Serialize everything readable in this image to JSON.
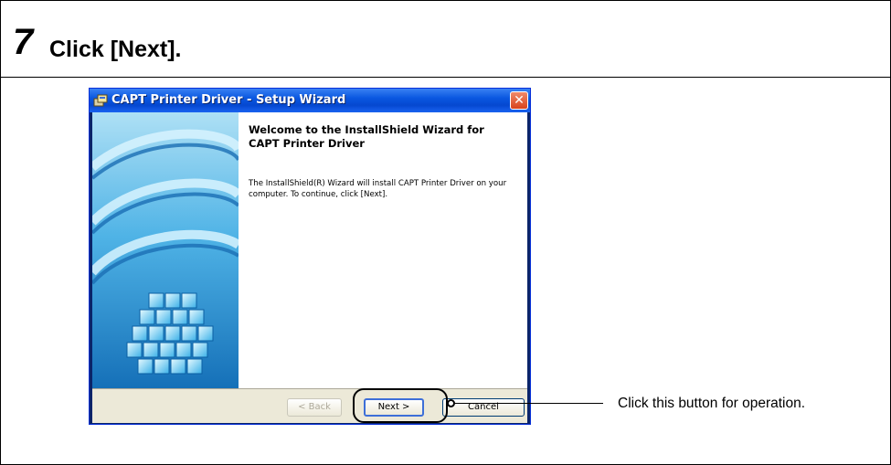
{
  "step": {
    "number": "7",
    "title": "Click [Next]."
  },
  "dialog": {
    "title": "CAPT Printer Driver - Setup Wizard",
    "close_label": "✕",
    "welcome_title": "Welcome to the InstallShield Wizard for CAPT Printer Driver",
    "welcome_body": "The InstallShield(R) Wizard will install CAPT Printer Driver on your computer. To continue, click [Next].",
    "buttons": {
      "back": "< Back",
      "next": "Next >",
      "cancel": "Cancel"
    }
  },
  "callout": {
    "text": "Click this button for operation."
  },
  "colors": {
    "titlebar": "#0a57e0",
    "art_blue": "#1e88d6",
    "dialog_face": "#ece9d8"
  }
}
